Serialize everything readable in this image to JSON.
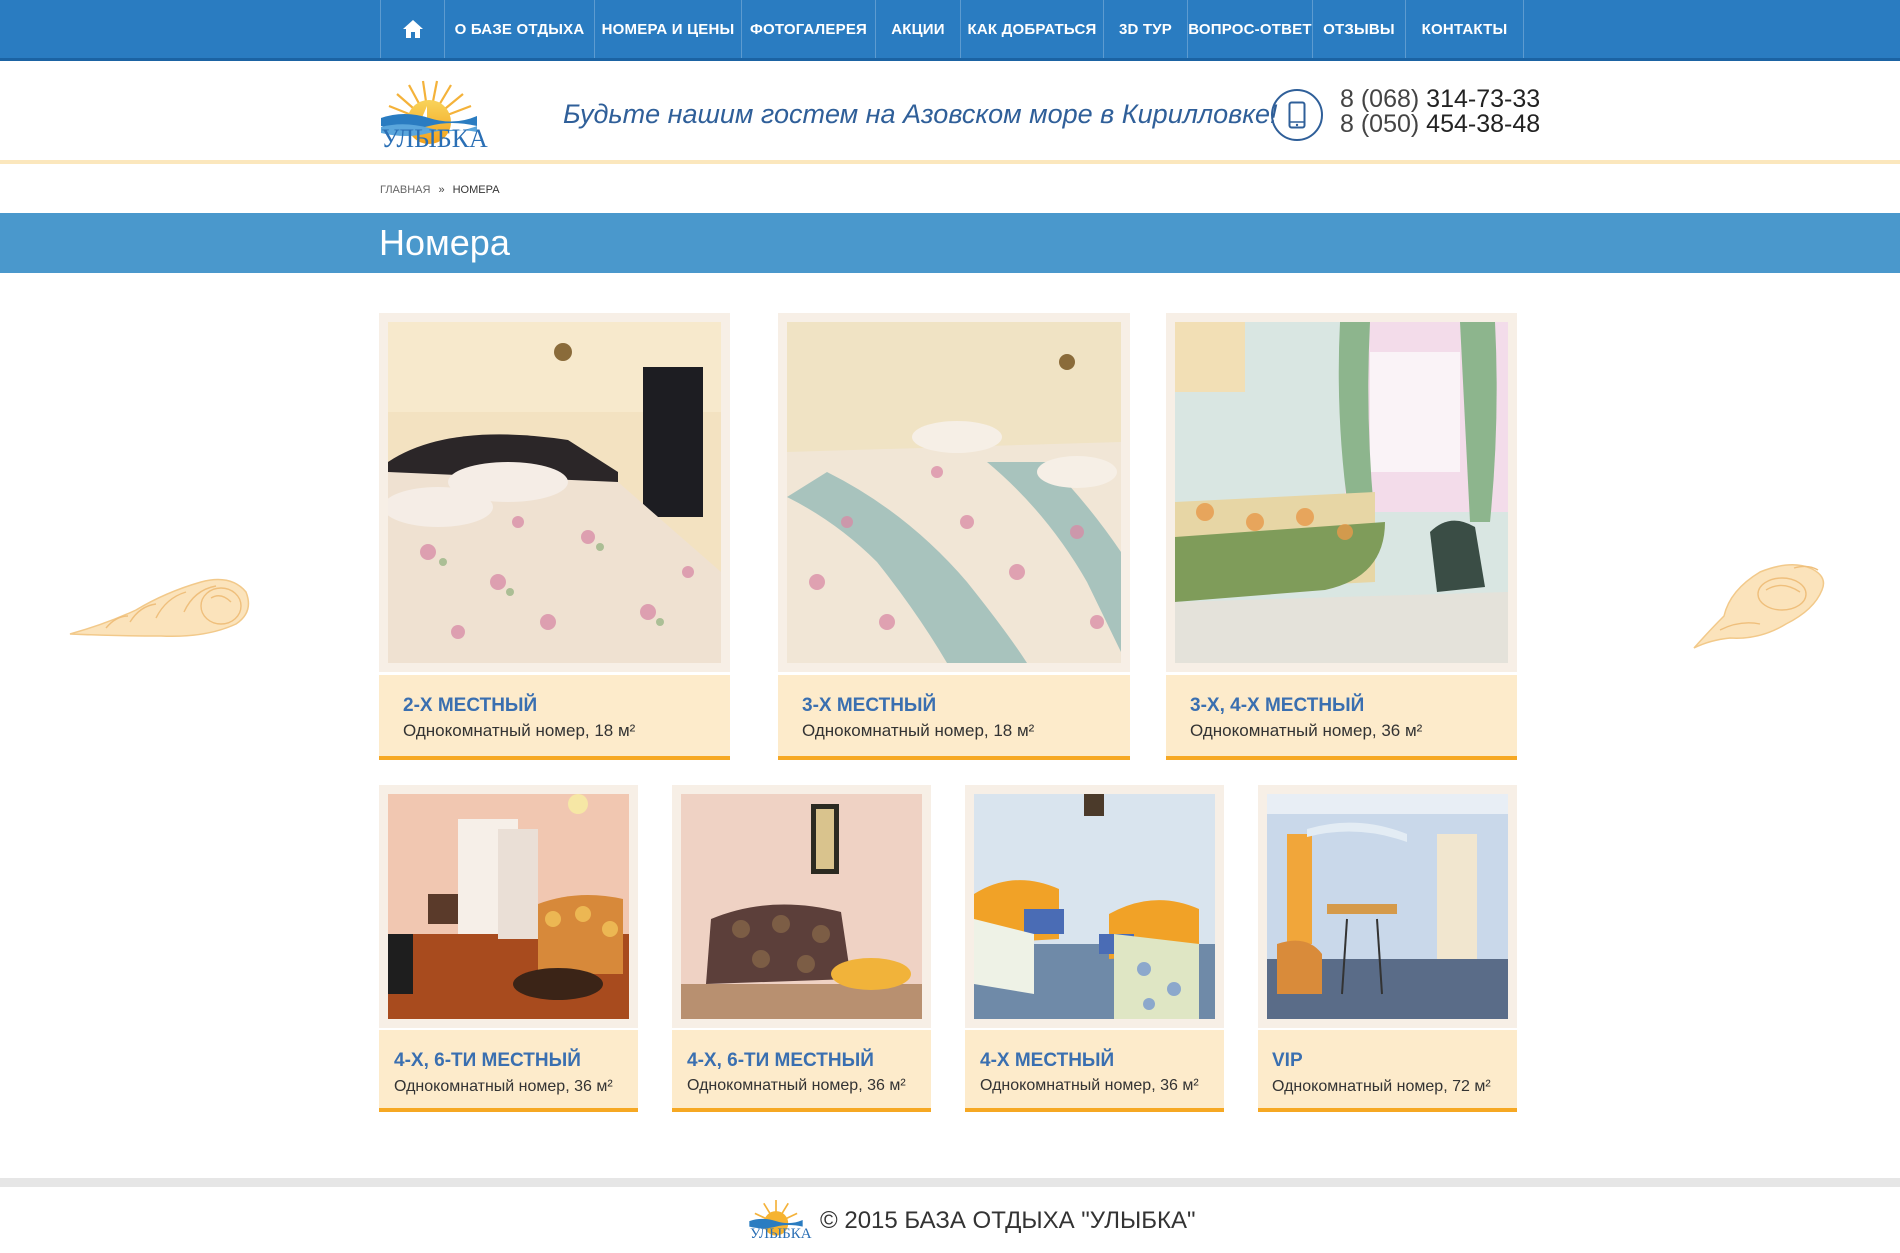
{
  "nav": {
    "home_icon": "home-icon",
    "items": [
      {
        "label": "О БАЗЕ ОТДЫХА"
      },
      {
        "label": "НОМЕРА И ЦЕНЫ"
      },
      {
        "label": "ФОТОГАЛЕРЕЯ"
      },
      {
        "label": "АКЦИИ"
      },
      {
        "label": "КАК ДОБРАТЬСЯ"
      },
      {
        "label": "3D ТУР"
      },
      {
        "label": "ВОПРОС-ОТВЕТ"
      },
      {
        "label": "ОТЗЫВЫ"
      },
      {
        "label": "КОНТАКТЫ"
      }
    ]
  },
  "header": {
    "logo_text": "УЛЫБКА",
    "slogan": "Будьте нашим гостем на Азовском море в Кирилловке!",
    "phone_icon": "mobile-phone-icon",
    "phones": [
      {
        "code": "8 (068)",
        "number": "314-73-33"
      },
      {
        "code": "8 (050)",
        "number": "454-38-48"
      }
    ]
  },
  "breadcrumb": {
    "home": "ГЛАВНАЯ",
    "separator": "»",
    "current": "НОМЕРА"
  },
  "page_title": "Номера",
  "rooms": [
    {
      "name": "2-Х  МЕСТНЫЙ",
      "desc": "Однокомнатный номер, 18 м²"
    },
    {
      "name": "3-Х  МЕСТНЫЙ",
      "desc": "Однокомнатный номер, 18 м²"
    },
    {
      "name": "3-Х, 4-Х МЕСТНЫЙ",
      "desc": "Однокомнатный номер, 36 м²"
    },
    {
      "name": "4-Х, 6-ТИ МЕСТНЫЙ",
      "desc": "Однокомнатный номер, 36 м²"
    },
    {
      "name": "4-Х, 6-ТИ МЕСТНЫЙ",
      "desc": "Однокомнатный номер, 36 м²"
    },
    {
      "name": "4-Х МЕСТНЫЙ",
      "desc": "Однокомнатный номер, 36 м²"
    },
    {
      "name": "VIP",
      "desc": "Однокомнатный номер, 72 м²"
    }
  ],
  "footer": {
    "logo_text": "УЛЫБКА",
    "copyright": "© 2015 БАЗА ОТДЫХА \"УЛЫБКА\""
  },
  "colors": {
    "nav_bg": "#2a7cc1",
    "title_bar": "#4a98cc",
    "card_info_bg": "#fdebcb",
    "card_accent": "#f6a823",
    "room_name": "#3a6fb0"
  }
}
